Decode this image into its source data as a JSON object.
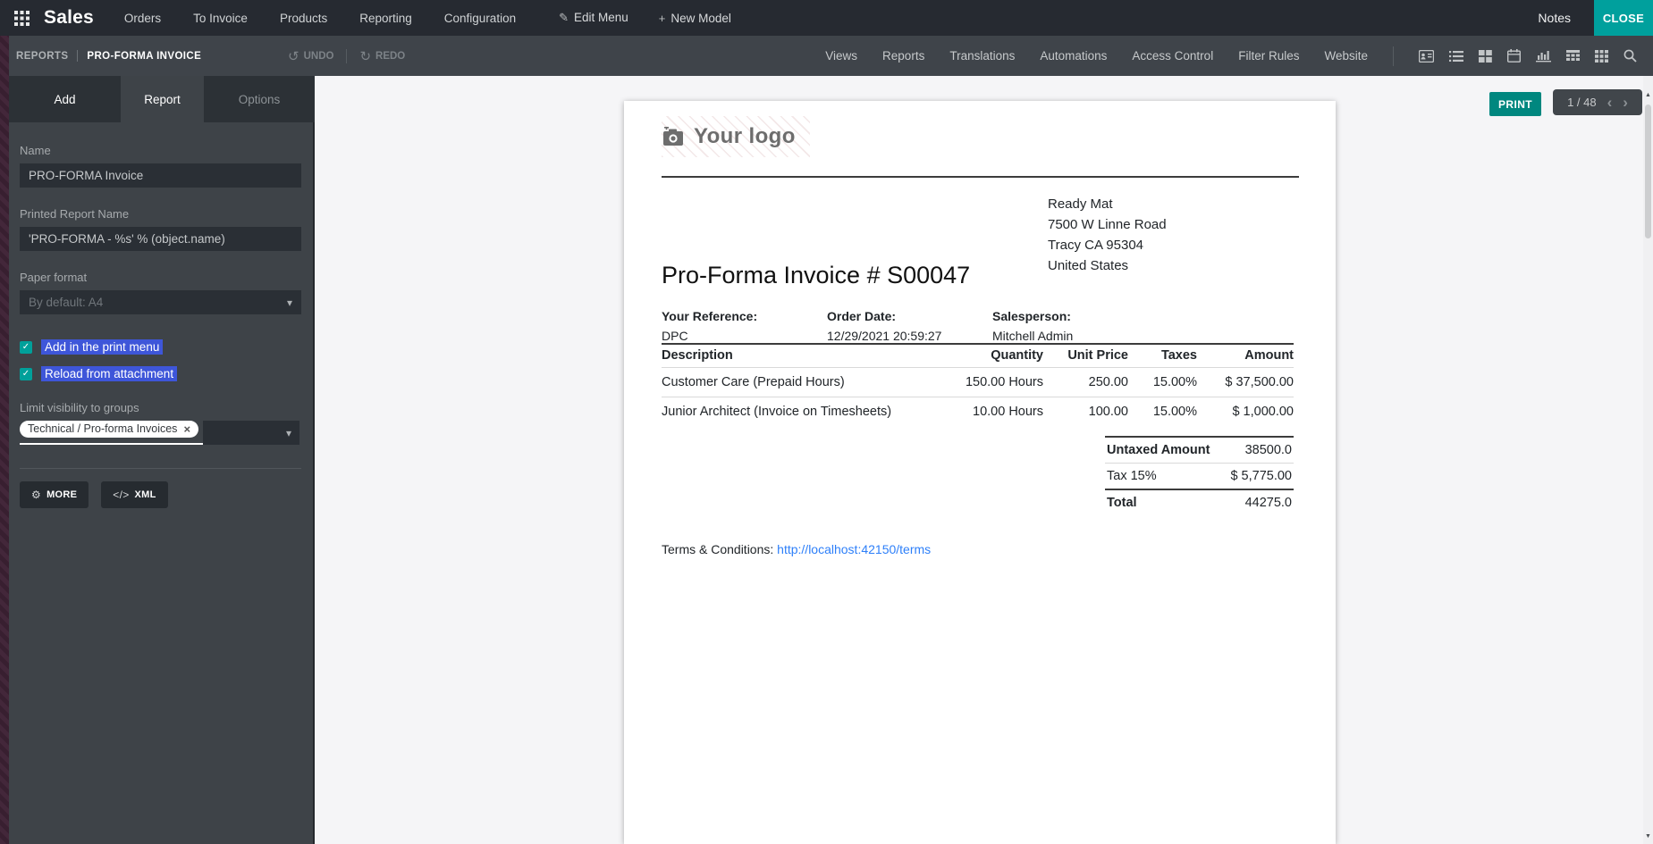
{
  "icons": {
    "pencil": "✎",
    "plus": "+",
    "undo": "↺",
    "redo": "↻",
    "gear": "⚙",
    "code": "</>",
    "check": "✓",
    "close_x": "×",
    "chevron_down": "▾",
    "prev": "‹",
    "next": "›",
    "up": "▲",
    "down": "▼"
  },
  "topnav": {
    "brand": "Sales",
    "items": [
      "Orders",
      "To Invoice",
      "Products",
      "Reporting",
      "Configuration"
    ],
    "edit_menu": "Edit Menu",
    "new_model": "New Model",
    "notes": "Notes",
    "close": "CLOSE"
  },
  "toolbar": {
    "breadcrumb_section": "REPORTS",
    "breadcrumb_current": "PRO-FORMA INVOICE",
    "undo": "UNDO",
    "redo": "REDO",
    "menu": [
      "Views",
      "Reports",
      "Translations",
      "Automations",
      "Access Control",
      "Filter Rules",
      "Website"
    ]
  },
  "sidebar": {
    "tabs": {
      "add": "Add",
      "report": "Report",
      "options": "Options"
    },
    "fields": {
      "name_label": "Name",
      "name_value": "PRO-FORMA Invoice",
      "printed_label": "Printed Report Name",
      "printed_value": "'PRO-FORMA - %s' % (object.name)",
      "paper_label": "Paper format",
      "paper_value": "By default: A4",
      "checkbox1": "Add in the print menu",
      "checkbox2": "Reload from attachment",
      "groups_label": "Limit visibility to groups",
      "group_tag": "Technical / Pro-forma Invoices"
    },
    "buttons": {
      "more": "MORE",
      "xml": "XML"
    }
  },
  "preview": {
    "print": "PRINT",
    "pager_text": "1 / 48"
  },
  "invoice": {
    "logo_text": "Your logo",
    "company_address": [
      "Ready Mat",
      "7500 W Linne Road",
      "Tracy CA 95304",
      "United States"
    ],
    "title": "Pro-Forma Invoice # S00047",
    "info": [
      {
        "label": "Your Reference:",
        "value": "DPC"
      },
      {
        "label": "Order Date:",
        "value": "12/29/2021 20:59:27"
      },
      {
        "label": "Salesperson:",
        "value": "Mitchell Admin"
      }
    ],
    "table": {
      "headers": [
        "Description",
        "Quantity",
        "Unit Price",
        "Taxes",
        "Amount"
      ],
      "rows": [
        [
          "Customer Care (Prepaid Hours)",
          "150.00 Hours",
          "250.00",
          "15.00%",
          "$ 37,500.00"
        ],
        [
          "Junior Architect (Invoice on Timesheets)",
          "10.00 Hours",
          "100.00",
          "15.00%",
          "$ 1,000.00"
        ]
      ]
    },
    "totals": [
      {
        "label": "Untaxed Amount",
        "value": "38500.0"
      },
      {
        "label": "Tax 15%",
        "value": "$ 5,775.00"
      },
      {
        "label": "Total",
        "value": "44275.0"
      }
    ],
    "terms_label": "Terms & Conditions:",
    "terms_link": "http://localhost:42150/terms"
  },
  "colors": {
    "accent_teal": "#00a09d",
    "print_teal": "#00877f",
    "highlight_blue": "#3e56d9",
    "topnav_bg": "#262a31",
    "toolbar_bg": "#3f444a",
    "sidebar_bg": "#3e4348",
    "link_blue": "#2d7ff9"
  }
}
